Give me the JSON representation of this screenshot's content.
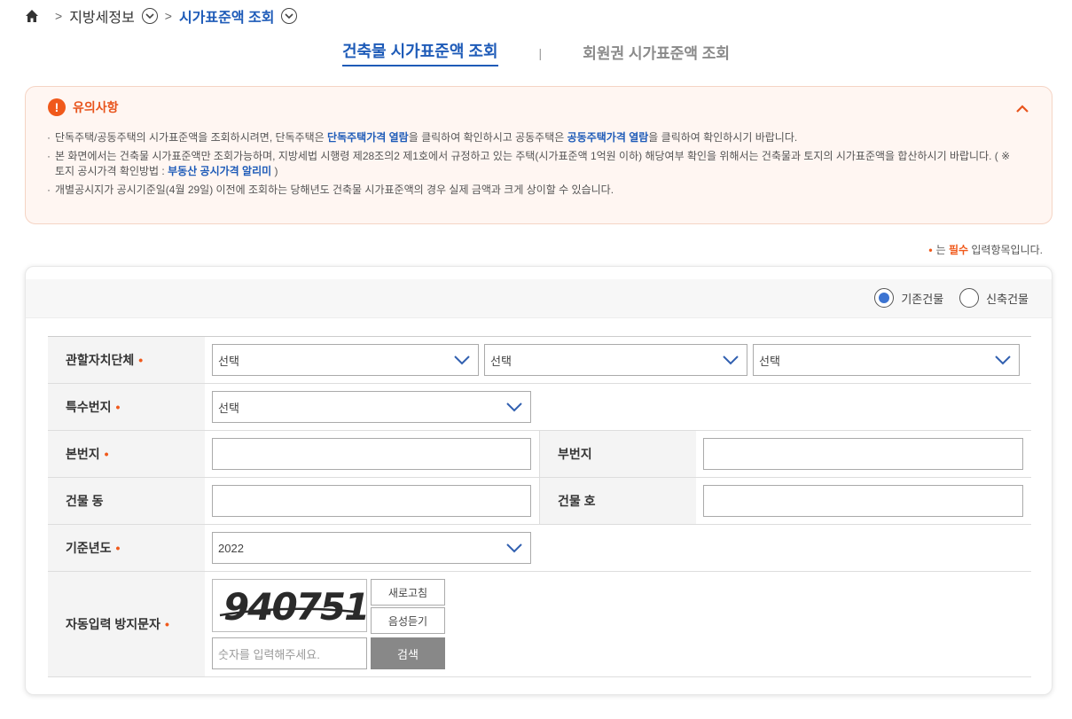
{
  "breadcrumb": {
    "level1": "지방세정보",
    "level2": "시가표준액 조회"
  },
  "tabs": [
    {
      "label": "건축물 시가표준액 조회",
      "active": true
    },
    {
      "label": "회원권 시가표준액 조회",
      "active": false
    }
  ],
  "notice": {
    "title": "유의사항",
    "item1": {
      "pre": "단독주택/공동주택의 시가표준액을 조회하시려면, 단독주택은 ",
      "link1": "단독주택가격 열람",
      "mid": "을 클릭하여 확인하시고 공동주택은 ",
      "link2": "공동주택가격 열람",
      "post": "을 클릭하여 확인하시기 바랍니다."
    },
    "item2": {
      "text": "본 화면에서는 건축물 시가표준액만 조회가능하며, 지방세법 시행령 제28조의2 제1호에서 규정하고 있는 주택(시가표준액 1억원 이하) 해당여부 확인을 위해서는 건축물과 토지의 시가표준액을 합산하시기 바랍니다. ( ※ 토지 공시가격 확인방법 : ",
      "link": "부동산 공시가격 알리미",
      "post": " )"
    },
    "item3": "개별공시지가 공시기준일(4월 29일) 이전에 조회하는 당해년도 건축물 시가표준액의 경우 실제 금액과 크게 상이할 수 있습니다."
  },
  "required_note": {
    "pre": "는 ",
    "bold": "필수",
    "post": " 입력항목입니다."
  },
  "radios": [
    {
      "label": "기존건물",
      "checked": true
    },
    {
      "label": "신축건물",
      "checked": false
    }
  ],
  "form": {
    "region_label": "관할자치단체",
    "region_selects": [
      "선택",
      "선택",
      "선택"
    ],
    "special_label": "특수번지",
    "special_select": "선택",
    "main_lot_label": "본번지",
    "main_lot_value": "",
    "sub_lot_label": "부번지",
    "sub_lot_value": "",
    "bldg_dong_label": "건물 동",
    "bldg_dong_value": "",
    "bldg_ho_label": "건물 호",
    "bldg_ho_value": "",
    "year_label": "기준년도",
    "year_value": "2022",
    "captcha_label": "자동입력 방지문자",
    "captcha_text": "940751",
    "refresh_label": "새로고침",
    "audio_label": "음성듣기",
    "captcha_placeholder": "숫자를 입력해주세요.",
    "search_label": "검색",
    "required_mark": "•"
  }
}
